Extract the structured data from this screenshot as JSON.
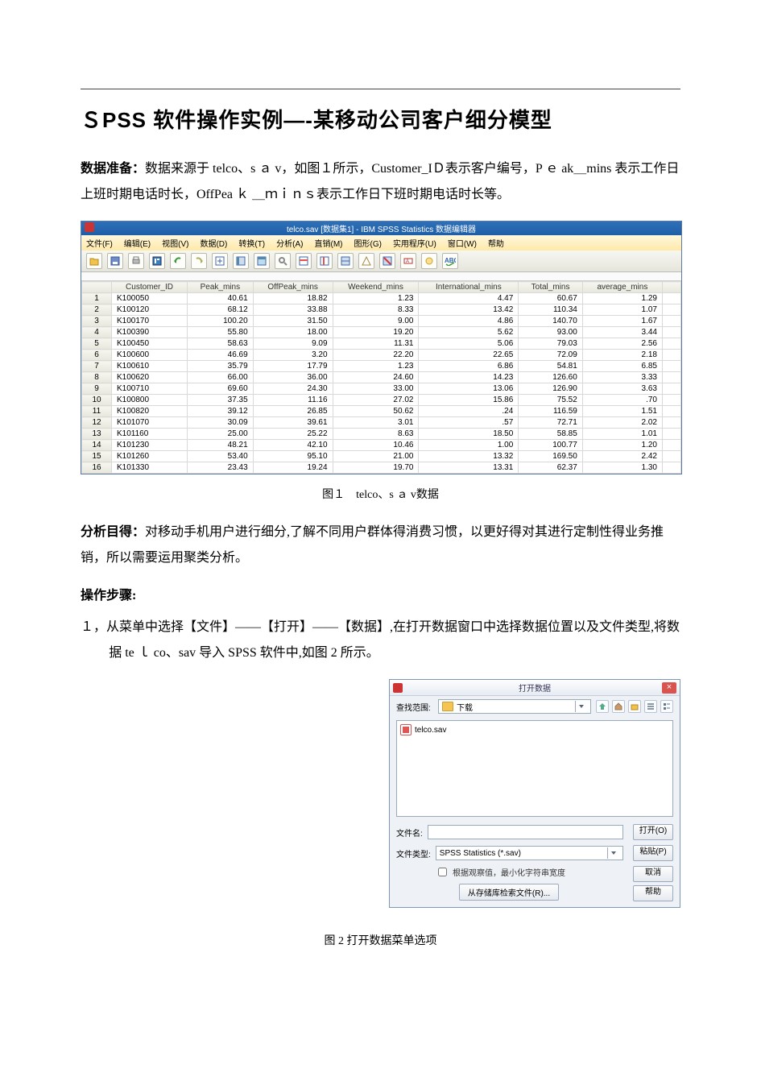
{
  "title": "ＳPSS 软件操作实例—-某移动公司客户细分模型",
  "prep_label": "数据准备：",
  "prep_text": "数据来源于 telco、s ａ v，如图１所示，Customer_IＤ表示客户编号，P ｅ ak＿mins 表示工作日上班时期电话时长，OffPea ｋ ＿ｍｉｎｓ表示工作日下班时期电话时长等。",
  "fig1_caption": "图１　telco、s ａ v数据",
  "goal_label": "分析目得：",
  "goal_text": "对移动手机用户进行细分,了解不同用户群体得消费习惯，以更好得对其进行定制性得业务推销，所以需要运用聚类分析。",
  "steps_head": "操作步骤:",
  "step1": "１，从菜单中选择【文件】——【打开】——【数据】,在打开数据窗口中选择数据位置以及文件类型,将数据 te ｌ co、sav 导入 SPSS 软件中,如图 2 所示。",
  "fig2_caption": "图 2 打开数据菜单选项",
  "spss": {
    "window_title": "telco.sav [数据集1] - IBM SPSS Statistics 数据编辑器",
    "menus": [
      "文件(F)",
      "编辑(E)",
      "视图(V)",
      "数据(D)",
      "转换(T)",
      "分析(A)",
      "直销(M)",
      "图形(G)",
      "实用程序(U)",
      "窗口(W)",
      "帮助"
    ],
    "columns": [
      "",
      "Customer_ID",
      "Peak_mins",
      "OffPeak_mins",
      "Weekend_mins",
      "International_mins",
      "Total_mins",
      "average_mins",
      ""
    ],
    "rows": [
      [
        "1",
        "K100050",
        "40.61",
        "18.82",
        "1.23",
        "4.47",
        "60.67",
        "1.29"
      ],
      [
        "2",
        "K100120",
        "68.12",
        "33.88",
        "8.33",
        "13.42",
        "110.34",
        "1.07"
      ],
      [
        "3",
        "K100170",
        "100.20",
        "31.50",
        "9.00",
        "4.86",
        "140.70",
        "1.67"
      ],
      [
        "4",
        "K100390",
        "55.80",
        "18.00",
        "19.20",
        "5.62",
        "93.00",
        "3.44"
      ],
      [
        "5",
        "K100450",
        "58.63",
        "9.09",
        "11.31",
        "5.06",
        "79.03",
        "2.56"
      ],
      [
        "6",
        "K100600",
        "46.69",
        "3.20",
        "22.20",
        "22.65",
        "72.09",
        "2.18"
      ],
      [
        "7",
        "K100610",
        "35.79",
        "17.79",
        "1.23",
        "6.86",
        "54.81",
        "6.85"
      ],
      [
        "8",
        "K100620",
        "66.00",
        "36.00",
        "24.60",
        "14.23",
        "126.60",
        "3.33"
      ],
      [
        "9",
        "K100710",
        "69.60",
        "24.30",
        "33.00",
        "13.06",
        "126.90",
        "3.63"
      ],
      [
        "10",
        "K100800",
        "37.35",
        "11.16",
        "27.02",
        "15.86",
        "75.52",
        ".70"
      ],
      [
        "11",
        "K100820",
        "39.12",
        "26.85",
        "50.62",
        ".24",
        "116.59",
        "1.51"
      ],
      [
        "12",
        "K101070",
        "30.09",
        "39.61",
        "3.01",
        ".57",
        "72.71",
        "2.02"
      ],
      [
        "13",
        "K101160",
        "25.00",
        "25.22",
        "8.63",
        "18.50",
        "58.85",
        "1.01"
      ],
      [
        "14",
        "K101230",
        "48.21",
        "42.10",
        "10.46",
        "1.00",
        "100.77",
        "1.20"
      ],
      [
        "15",
        "K101260",
        "53.40",
        "95.10",
        "21.00",
        "13.32",
        "169.50",
        "2.42"
      ],
      [
        "16",
        "K101330",
        "23.43",
        "19.24",
        "19.70",
        "13.31",
        "62.37",
        "1.30"
      ]
    ]
  },
  "dlg": {
    "title": "打开数据",
    "lookin_label": "查找范围:",
    "lookin_value": "下载",
    "file_item": "telco.sav",
    "filename_label": "文件名:",
    "filename_value": "",
    "filetype_label": "文件类型:",
    "filetype_value": "SPSS Statistics (*.sav)",
    "check_label": "根据观察值，最小化字符串宽度",
    "repo_btn": "从存储库检索文件(R)...",
    "btns": {
      "open": "打开(O)",
      "paste": "粘贴(P)",
      "cancel": "取消",
      "help": "帮助"
    }
  }
}
